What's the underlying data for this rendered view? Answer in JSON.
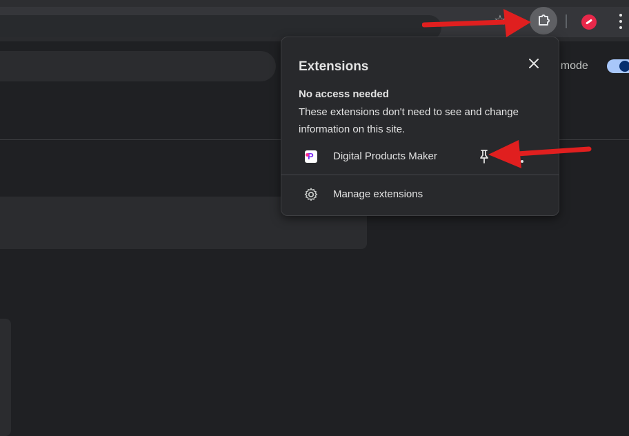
{
  "popup": {
    "title": "Extensions",
    "section_title": "No access needed",
    "section_desc": "These extensions don't need to see and change information on this site.",
    "extensions": [
      {
        "name": "Digital Products Maker",
        "icon": "digital-products-maker-icon"
      }
    ],
    "manage_label": "Manage extensions"
  },
  "page": {
    "mode_text": "r mode"
  },
  "colors": {
    "annotation_arrow": "#e01f1f",
    "accent": "#a8c7fa",
    "background": "#1f2023",
    "popup_background": "#28292c"
  }
}
